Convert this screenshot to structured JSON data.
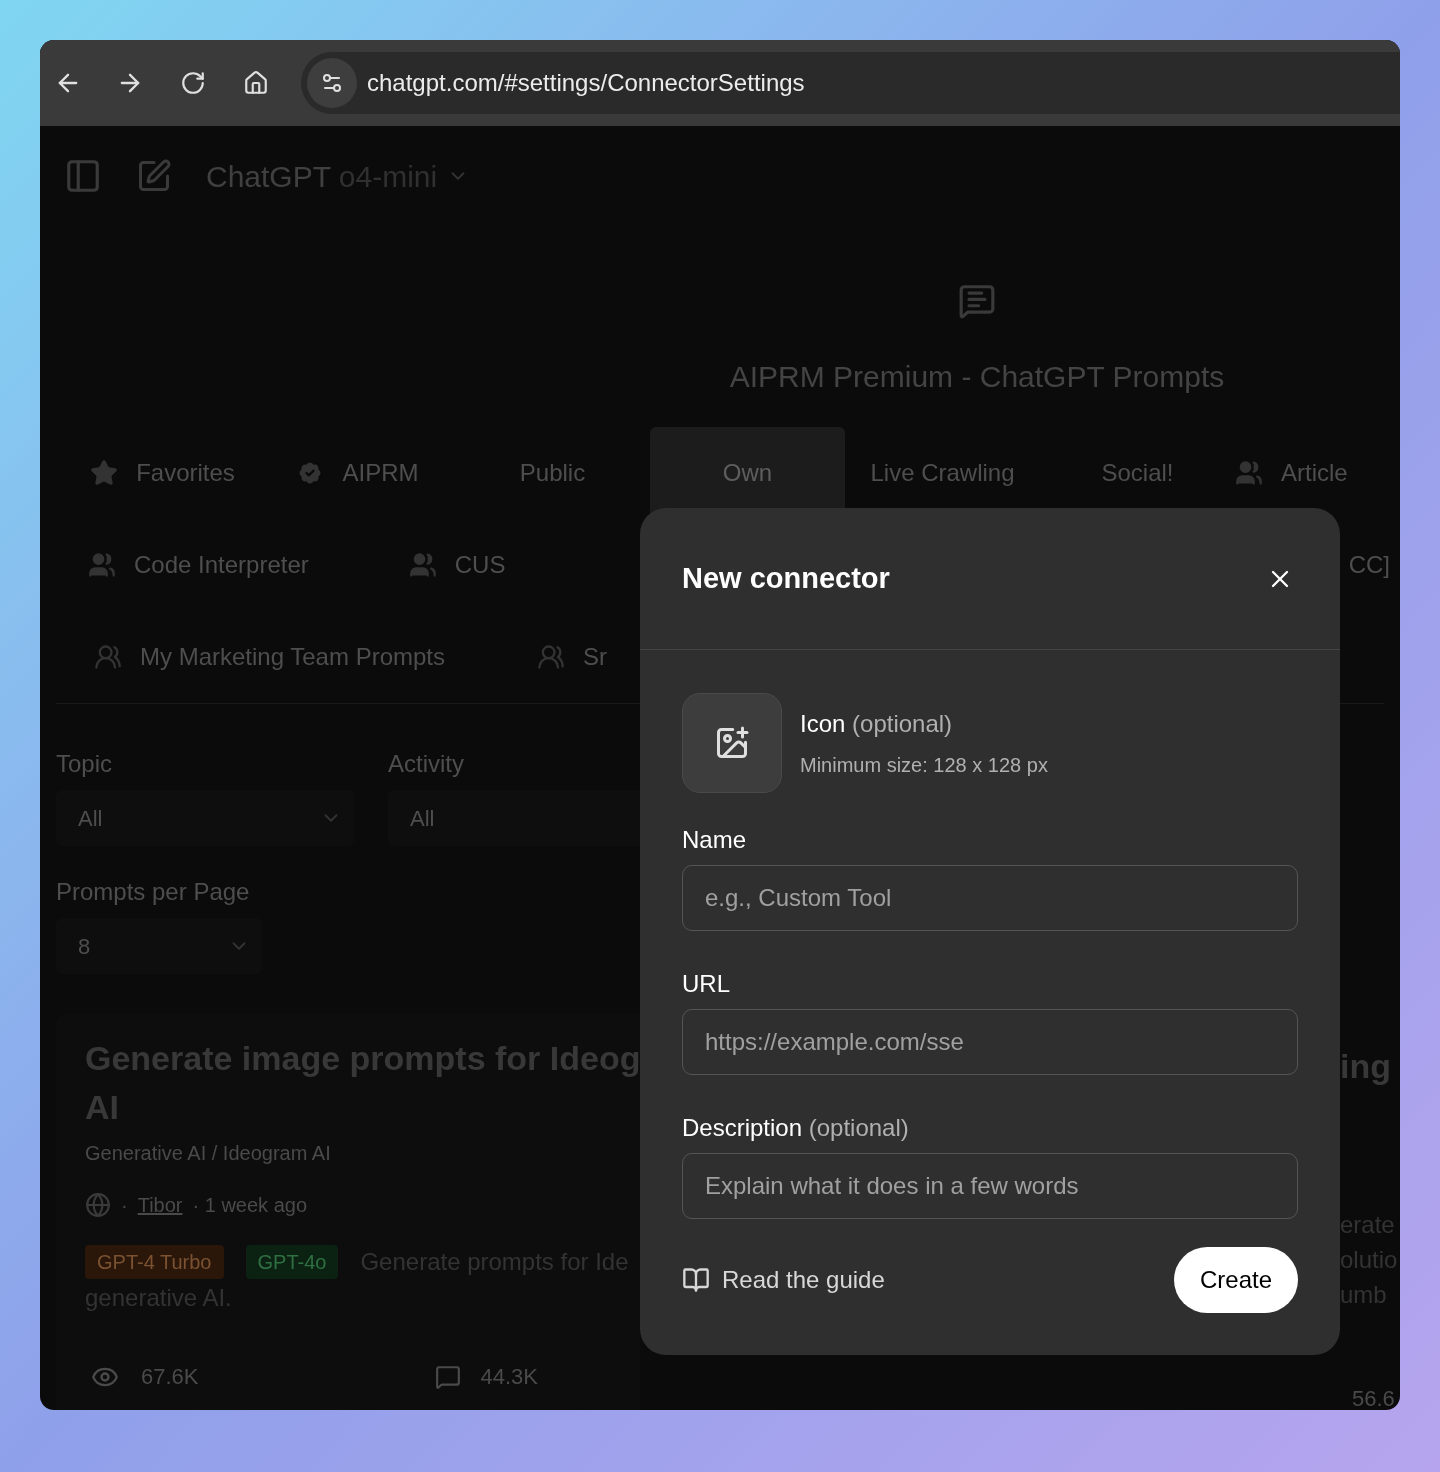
{
  "browser": {
    "url": "chatgpt.com/#settings/ConnectorSettings"
  },
  "header": {
    "product": "ChatGPT",
    "model": "o4-mini"
  },
  "hero": {
    "title": "AIPRM Premium - ChatGPT Prompts"
  },
  "tab_rows": [
    {
      "tabs": [
        {
          "label": "Favorites",
          "kind": "star",
          "selected": false
        },
        {
          "label": "AIPRM",
          "kind": "badge",
          "selected": false
        },
        {
          "label": "Public",
          "kind": "plain",
          "selected": false
        },
        {
          "label": "Own",
          "kind": "plain",
          "selected": true
        },
        {
          "label": "Live Crawling",
          "kind": "plain",
          "selected": false
        },
        {
          "label": "Social!",
          "kind": "plain",
          "selected": false
        },
        {
          "label": "Article",
          "kind": "group",
          "selected": false
        }
      ]
    },
    {
      "tabs": [
        {
          "label": "Code Interpreter",
          "kind": "group",
          "selected": false
        },
        {
          "label": "CUS",
          "kind": "group",
          "selected": false
        }
      ],
      "right_tab": "CC]"
    },
    {
      "tabs": [
        {
          "label": "My Marketing Team Prompts",
          "kind": "people",
          "selected": false
        },
        {
          "label": "Sr",
          "kind": "people",
          "selected": false
        }
      ]
    }
  ],
  "filters": [
    {
      "label": "Topic",
      "value": "All"
    },
    {
      "label": "Activity",
      "value": "All"
    }
  ],
  "per_page": {
    "label": "Prompts per Page",
    "value": "8"
  },
  "card": {
    "title_lines": [
      "Generate image prompts for Ideog",
      "AI"
    ],
    "category": "Generative AI / Ideogram AI",
    "author_prefix": "·",
    "author": "Tibor",
    "time": "· 1 week ago",
    "tags": [
      {
        "label": "GPT-4 Turbo",
        "color": "#2b1709"
      },
      {
        "label": "GPT-4o",
        "color": "#0b2212"
      }
    ],
    "teaser_lines": [
      "Generate prompts for Ide",
      "generative AI."
    ],
    "views": "67.6K",
    "comments": "44.3K"
  },
  "card_right": {
    "title": "ing",
    "teaser_lines": [
      "erate",
      "olutio",
      "umb"
    ],
    "comments": "56.6"
  },
  "modal": {
    "title": "New connector",
    "icon_field": {
      "label": "Icon",
      "note": "(optional)",
      "hint": "Minimum size: 128 x 128 px"
    },
    "fields": [
      {
        "label": "Name",
        "placeholder": "e.g., Custom Tool"
      },
      {
        "label": "URL",
        "placeholder": "https://example.com/sse"
      },
      {
        "label": "Description",
        "note": "(optional)",
        "placeholder": "Explain what it does in a few words"
      }
    ],
    "guide_link": "Read the guide",
    "create_button": "Create"
  }
}
